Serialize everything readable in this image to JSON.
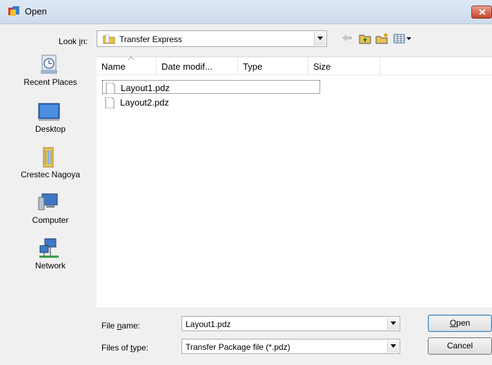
{
  "title": "Open",
  "look_in": {
    "label": "Look in:",
    "value": "Transfer Express"
  },
  "places": [
    {
      "label": "Recent Places",
      "icon": "recent-places-icon"
    },
    {
      "label": "Desktop",
      "icon": "desktop-icon"
    },
    {
      "label": "Crestec Nagoya",
      "icon": "user-folder-icon"
    },
    {
      "label": "Computer",
      "icon": "computer-icon"
    },
    {
      "label": "Network",
      "icon": "network-icon"
    }
  ],
  "columns": [
    "Name",
    "Date modif...",
    "Type",
    "Size"
  ],
  "files": [
    {
      "name": "Layout1.pdz",
      "selected": true
    },
    {
      "name": "Layout2.pdz",
      "selected": false
    }
  ],
  "file_name": {
    "label": "File name:",
    "value": "Layout1.pdz"
  },
  "file_type": {
    "label": "Files of type:",
    "value": "Transfer Package file (*.pdz)"
  },
  "buttons": {
    "open": "Open",
    "cancel": "Cancel"
  }
}
